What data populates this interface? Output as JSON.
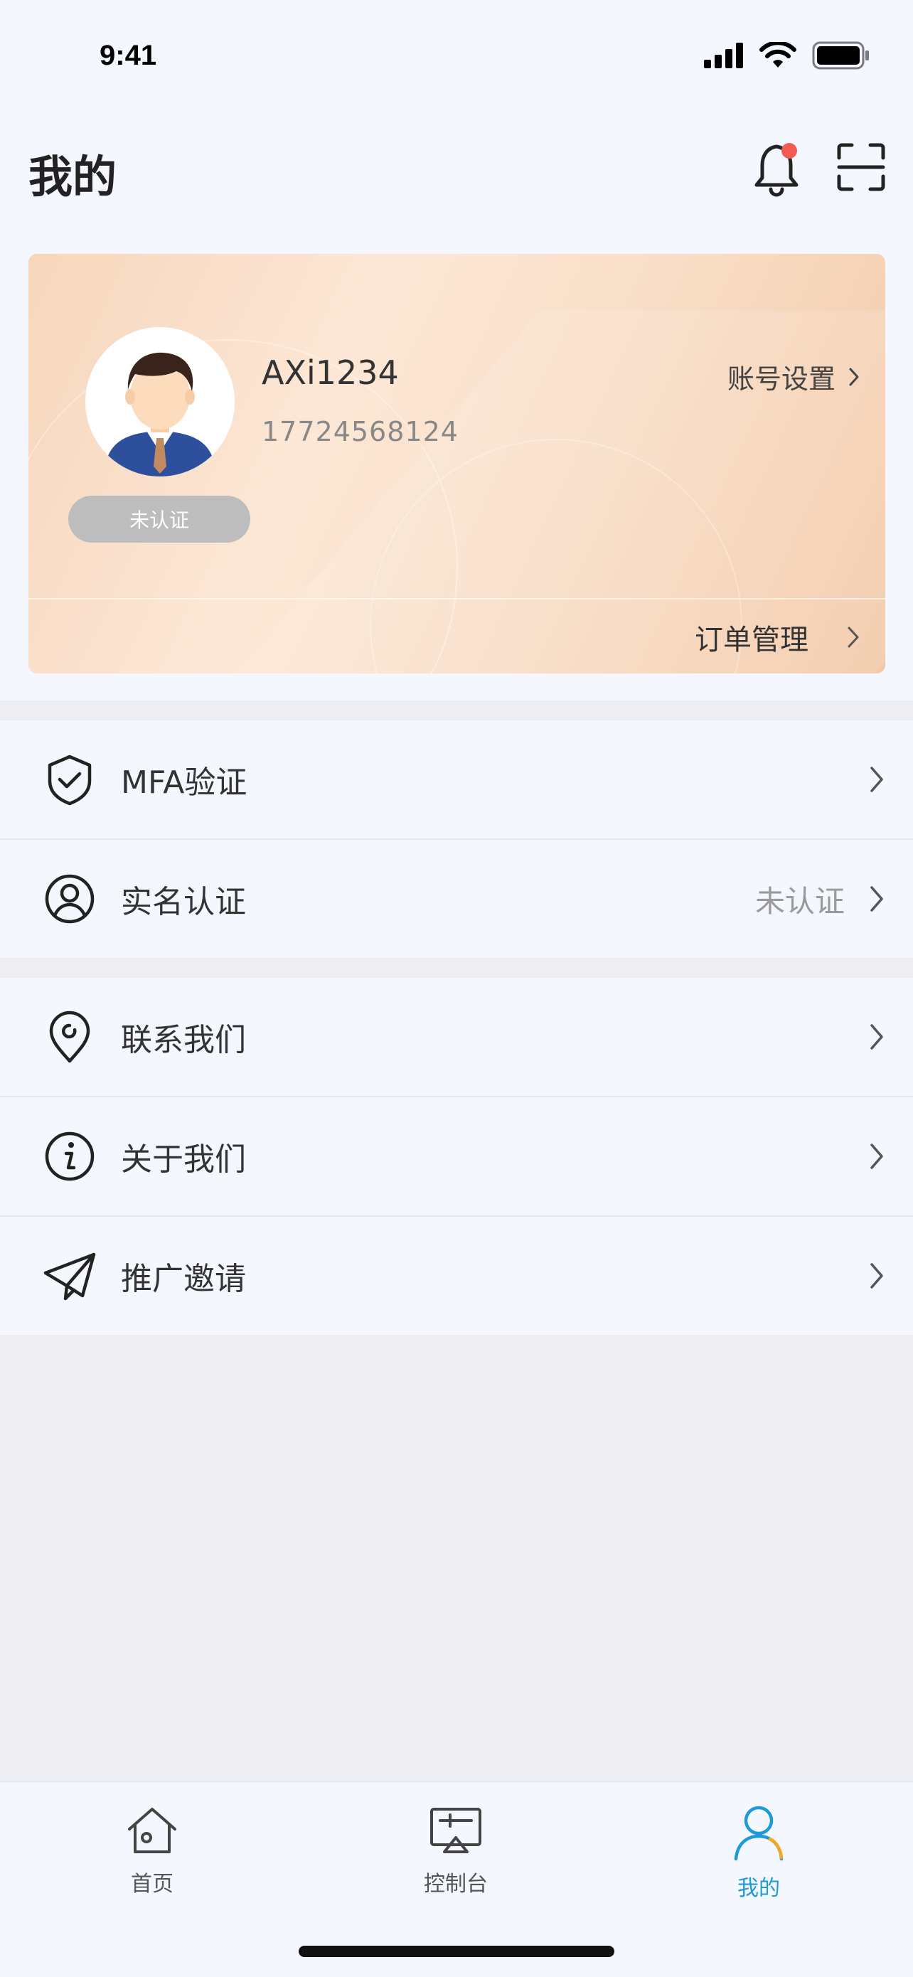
{
  "status_bar": {
    "time": "9:41"
  },
  "header": {
    "title": "我的"
  },
  "profile": {
    "username": "AXi1234",
    "phone": "17724568124",
    "auth_status": "未认证",
    "account_settings_label": "账号设置",
    "order_management_label": "订单管理"
  },
  "menu_group_1": [
    {
      "label": "MFA验证",
      "icon": "shield-check-icon"
    },
    {
      "label": "实名认证",
      "value": "未认证",
      "icon": "user-circle-icon"
    }
  ],
  "menu_group_2": [
    {
      "label": "联系我们",
      "icon": "location-pin-icon"
    },
    {
      "label": "关于我们",
      "icon": "info-circle-icon"
    },
    {
      "label": "推广邀请",
      "icon": "paper-plane-icon"
    }
  ],
  "tabbar": {
    "items": [
      {
        "label": "首页",
        "icon": "home-icon"
      },
      {
        "label": "控制台",
        "icon": "console-icon"
      },
      {
        "label": "我的",
        "icon": "user-icon",
        "active": true
      }
    ]
  },
  "colors": {
    "accent": "#1E9AD6",
    "notification_dot": "#F25C54",
    "background": "#F4F7FD"
  }
}
